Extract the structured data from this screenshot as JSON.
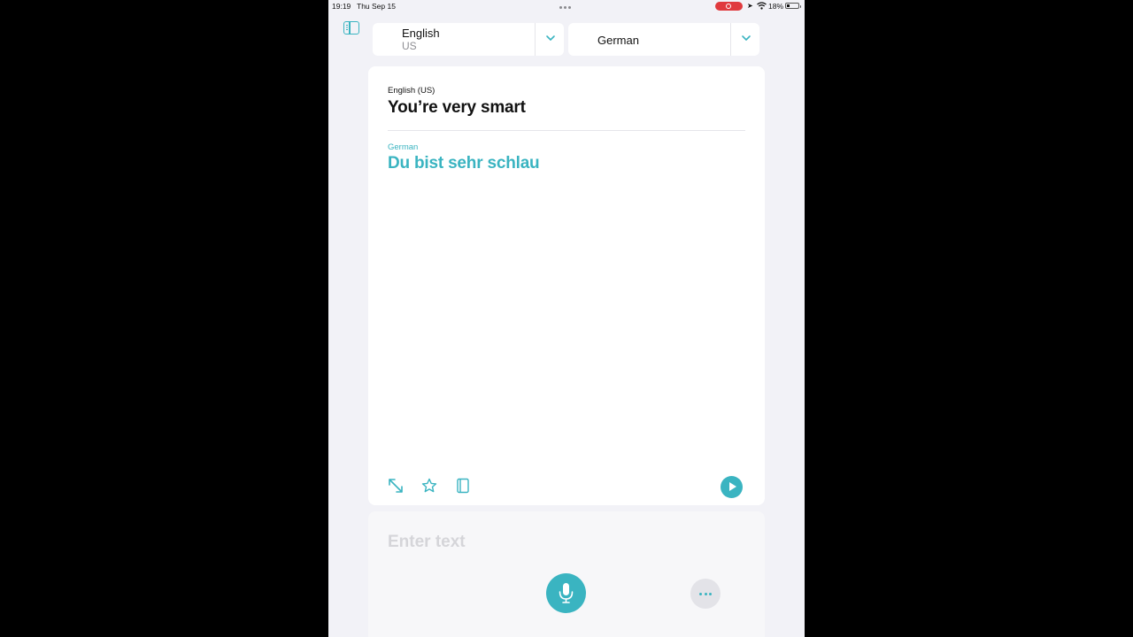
{
  "status_bar": {
    "time": "19:19",
    "date": "Thu Sep 15",
    "battery": "18%"
  },
  "header": {
    "source_language": {
      "name": "English",
      "region": "US"
    },
    "target_language": {
      "name": "German"
    }
  },
  "translation": {
    "source_label": "English (US)",
    "source_text": "You’re very smart",
    "target_label": "German",
    "target_text": "Du bist sehr schlau"
  },
  "input": {
    "placeholder": "Enter text"
  },
  "colors": {
    "accent": "#3ab4c1",
    "background": "#f2f2f7",
    "card": "#ffffff",
    "recording": "#e03a3e"
  },
  "icons": [
    "sidebar-toggle-icon",
    "chevron-down-icon",
    "expand-icon",
    "star-icon",
    "book-icon",
    "play-icon",
    "microphone-icon",
    "more-icon"
  ]
}
